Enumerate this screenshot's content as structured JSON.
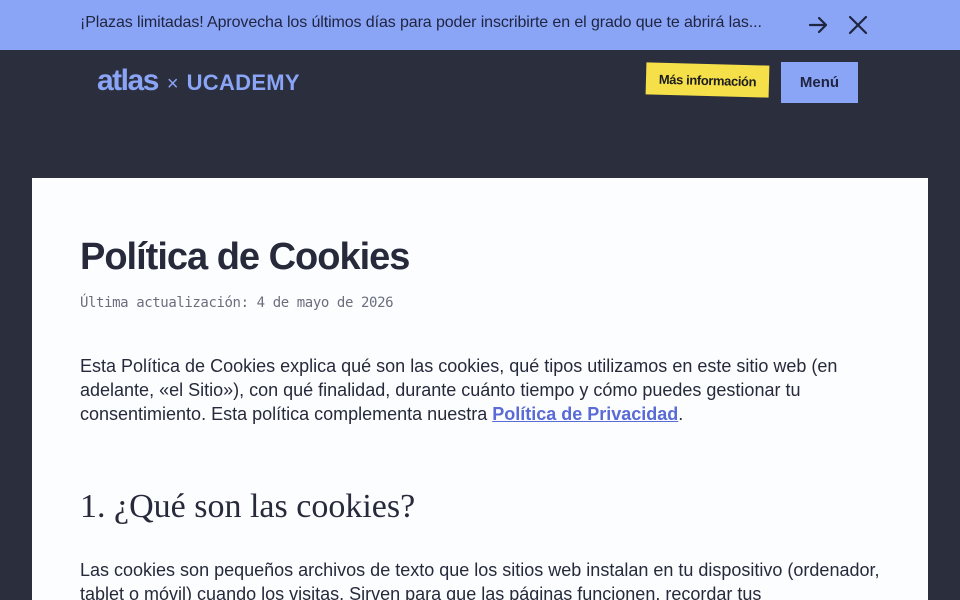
{
  "banner": {
    "text": "¡Plazas limitadas! Aprovecha los últimos días para poder inscribirte en el grado que te abrirá las...",
    "arrow_icon": "arrow-right-icon",
    "close_icon": "close-icon"
  },
  "header": {
    "logo_primary": "atlas",
    "logo_separator": "×",
    "logo_secondary": "UCADEMY",
    "more_info_label": "Más información",
    "menu_label": "Menú"
  },
  "content": {
    "title": "Política de Cookies",
    "updated": "Última actualización: 4 de mayo de 2026",
    "intro_text": "Esta Política de Cookies explica qué son las cookies, qué tipos utilizamos en este sitio web (en adelante, «el Sitio»), con qué finalidad, durante cuánto tiempo y cómo puedes gestionar tu consentimiento. Esta política complementa nuestra ",
    "intro_link": "Política de Privacidad",
    "intro_end": ".",
    "section1_title": "1. ¿Qué son las cookies?",
    "section1_body": "Las cookies son pequeños archivos de texto que los sitios web instalan en tu dispositivo (ordenador, tablet o móvil) cuando los visitas. Sirven para que las páginas funcionen, recordar tus"
  },
  "colors": {
    "banner_bg": "#8aa4f6",
    "page_bg": "#2b2e3d",
    "accent_yellow": "#f5e04a",
    "link": "#5a6ad6",
    "card_bg": "#fbfdff"
  }
}
